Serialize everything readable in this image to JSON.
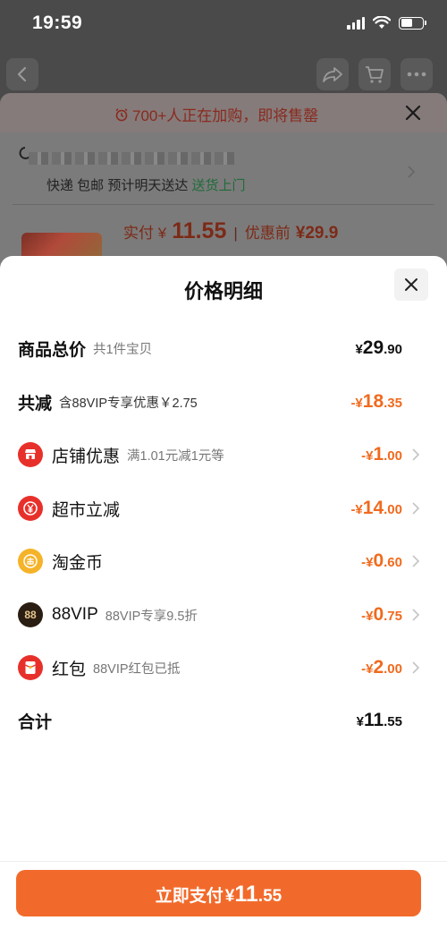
{
  "status": {
    "time": "19:59"
  },
  "background": {
    "banner_text": "700+人正在加购，即将售罄",
    "address_blurred": "",
    "delivery_text": "快递 包邮 预计明天送达",
    "delivery_green": "送货上门",
    "price_label": "实付 ¥",
    "price_value": "11.55",
    "before_label": "优惠前",
    "before_value": "¥29.9"
  },
  "modal": {
    "title": "价格明细",
    "rows": [
      {
        "label": "商品总价",
        "sub": "共1件宝贝",
        "cur": "¥",
        "int": "29",
        "dec": ".90"
      },
      {
        "label": "共减",
        "sub": "含88VIP专享优惠￥2.75",
        "cur": "-¥",
        "int": "18",
        "dec": ".35"
      },
      {
        "label": "店铺优惠",
        "sub": "满1.01元减1元等",
        "cur": "-¥",
        "int": "1",
        "dec": ".00",
        "icon": "store-icon"
      },
      {
        "label": "超市立减",
        "sub": "",
        "cur": "-¥",
        "int": "14",
        "dec": ".00",
        "icon": "supermarket-icon"
      },
      {
        "label": "淘金币",
        "sub": "",
        "cur": "-¥",
        "int": "0",
        "dec": ".60",
        "icon": "taojinbi-coin-icon"
      },
      {
        "label": "88VIP",
        "sub": "88VIP专享9.5折",
        "cur": "-¥",
        "int": "0",
        "dec": ".75",
        "icon": "vip88-icon",
        "icon_text": "88"
      },
      {
        "label": "红包",
        "sub": "88VIP红包已抵",
        "cur": "-¥",
        "int": "2",
        "dec": ".00",
        "icon": "red-envelope-icon"
      },
      {
        "label": "合计",
        "sub": "",
        "cur": "¥",
        "int": "11",
        "dec": ".55"
      }
    ]
  },
  "footer": {
    "pay_text": "立即支付",
    "cur": "¥",
    "int": "11",
    "dec": ".55"
  },
  "colors": {
    "accent": "#f26a2b",
    "discount": "#f06a1e",
    "red_icon": "#e8302b",
    "coin": "#f5b32a"
  }
}
